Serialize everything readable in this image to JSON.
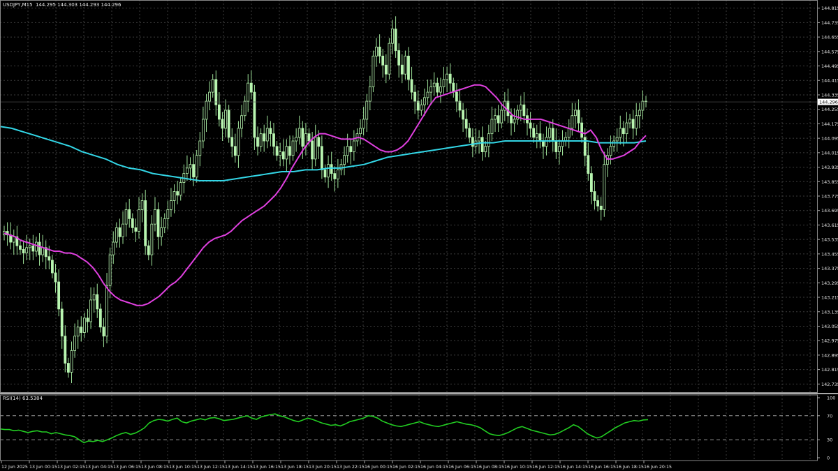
{
  "header": {
    "symbol": "USDJPY,M15",
    "ohlc": "144.295 144.303 144.293 144.296"
  },
  "rsi_header": {
    "label": "RSI(14) 63.5384"
  },
  "colors": {
    "background": "#000000",
    "grid": "#3c3c3c",
    "candle": "#b8f5b0",
    "wick": "#9fe39a",
    "ma_fast": "#e040e0",
    "ma_slow": "#33d6e6",
    "rsi": "#22cc22",
    "axis_text": "#e6e6e6"
  },
  "chart_data": [
    {
      "type": "candlestick",
      "title": "USDJPY,M15",
      "ylim": [
        142.69,
        144.86
      ],
      "yticks": [
        "144.815",
        "144.735",
        "144.655",
        "144.575",
        "144.495",
        "144.415",
        "144.335",
        "144.255",
        "144.175",
        "144.095",
        "144.015",
        "143.935",
        "143.855",
        "143.775",
        "143.695",
        "143.615",
        "143.535",
        "143.455",
        "143.375",
        "143.295",
        "143.215",
        "143.135",
        "143.055",
        "142.975",
        "142.895",
        "142.815",
        "142.735"
      ],
      "current_price": "144.296",
      "candles_close": [
        143.58,
        143.56,
        143.52,
        143.55,
        143.5,
        143.48,
        143.46,
        143.49,
        143.5,
        143.47,
        143.52,
        143.45,
        143.49,
        143.44,
        143.42,
        143.35,
        143.3,
        143.15,
        143.0,
        142.85,
        142.8,
        142.92,
        143.0,
        143.05,
        143.02,
        143.1,
        143.08,
        143.2,
        143.23,
        143.15,
        143.05,
        143.0,
        143.28,
        143.45,
        143.52,
        143.6,
        143.55,
        143.62,
        143.7,
        143.65,
        143.6,
        143.58,
        143.7,
        143.75,
        143.5,
        143.45,
        143.62,
        143.7,
        143.55,
        143.6,
        143.65,
        143.7,
        143.75,
        143.8,
        143.78,
        143.85,
        143.9,
        143.93,
        143.95,
        143.88,
        144.0,
        144.08,
        144.2,
        144.3,
        144.35,
        144.42,
        144.28,
        144.2,
        144.15,
        144.25,
        144.1,
        144.05,
        144.0,
        144.15,
        144.22,
        144.3,
        144.4,
        144.35,
        144.1,
        144.05,
        144.12,
        144.08,
        144.15,
        144.12,
        144.05,
        144.0,
        144.02,
        143.98,
        144.05,
        144.0,
        144.08,
        144.1,
        144.15,
        144.05,
        144.12,
        144.08,
        143.98,
        144.1,
        144.05,
        143.92,
        143.88,
        143.95,
        143.9,
        143.87,
        143.92,
        143.95,
        144.0,
        144.05,
        144.02,
        144.08,
        144.12,
        144.15,
        144.2,
        144.3,
        144.38,
        144.55,
        144.6,
        144.55,
        144.5,
        144.45,
        144.62,
        144.7,
        144.58,
        144.5,
        144.45,
        144.55,
        144.42,
        144.35,
        144.3,
        144.25,
        144.28,
        144.32,
        144.35,
        144.38,
        144.4,
        144.35,
        144.38,
        144.42,
        144.45,
        144.4,
        144.35,
        144.3,
        144.25,
        144.2,
        144.15,
        144.1,
        144.05,
        144.08,
        144.1,
        144.02,
        144.05,
        144.12,
        144.2,
        144.22,
        144.18,
        144.25,
        144.3,
        144.22,
        144.18,
        144.2,
        144.25,
        144.28,
        144.22,
        144.18,
        144.15,
        144.1,
        144.12,
        144.08,
        144.05,
        144.1,
        144.15,
        144.08,
        144.02,
        144.05,
        144.08,
        144.1,
        144.15,
        144.22,
        144.25,
        144.18,
        144.1,
        144.0,
        143.9,
        143.8,
        143.75,
        143.72,
        143.7,
        143.95,
        144.0,
        144.05,
        144.08,
        144.1,
        144.15,
        144.12,
        144.18,
        144.2,
        144.15,
        144.22,
        144.25,
        144.3,
        144.296
      ],
      "ma_fast_values": [
        143.57,
        143.56,
        143.55,
        143.53,
        143.52,
        143.51,
        143.5,
        143.49,
        143.48,
        143.47,
        143.47,
        143.46,
        143.46,
        143.45,
        143.43,
        143.41,
        143.38,
        143.34,
        143.29,
        143.25,
        143.22,
        143.2,
        143.19,
        143.18,
        143.17,
        143.17,
        143.18,
        143.2,
        143.22,
        143.25,
        143.28,
        143.3,
        143.33,
        143.37,
        143.41,
        143.45,
        143.49,
        143.52,
        143.54,
        143.55,
        143.56,
        143.58,
        143.61,
        143.64,
        143.66,
        143.68,
        143.7,
        143.72,
        143.75,
        143.78,
        143.82,
        143.87,
        143.93,
        143.98,
        144.03,
        144.07,
        144.1,
        144.12,
        144.12,
        144.11,
        144.1,
        144.09,
        144.09,
        144.09,
        144.1,
        144.09,
        144.07,
        144.05,
        144.03,
        144.02,
        144.02,
        144.03,
        144.05,
        144.08,
        144.13,
        144.18,
        144.23,
        144.28,
        144.32,
        144.33,
        144.34,
        144.35,
        144.36,
        144.37,
        144.38,
        144.39,
        144.39,
        144.38,
        144.35,
        144.32,
        144.28,
        144.25,
        144.22,
        144.21,
        144.2,
        144.2,
        144.2,
        144.2,
        144.19,
        144.18,
        144.17,
        144.16,
        144.15,
        144.14,
        144.13,
        144.12,
        144.14,
        144.1,
        144.03,
        143.98,
        143.98,
        143.99,
        144.0,
        144.02,
        144.04,
        144.08,
        144.11
      ],
      "ma_slow_values": [
        144.16,
        144.15,
        144.13,
        144.11,
        144.09,
        144.07,
        144.05,
        144.02,
        144.0,
        143.98,
        143.95,
        143.93,
        143.92,
        143.9,
        143.89,
        143.88,
        143.87,
        143.86,
        143.86,
        143.86,
        143.87,
        143.88,
        143.89,
        143.9,
        143.91,
        143.91,
        143.92,
        143.92,
        143.93,
        143.93,
        143.94,
        143.95,
        143.97,
        143.99,
        144.0,
        144.01,
        144.02,
        144.03,
        144.04,
        144.05,
        144.06,
        144.07,
        144.07,
        144.08,
        144.08,
        144.08,
        144.08,
        144.08,
        144.08,
        144.08,
        144.08,
        144.07,
        144.07,
        144.07,
        144.07,
        144.08
      ],
      "xticks": [
        "12 Jun 2025",
        "13 Jun 00:15",
        "13 Jun 02:15",
        "13 Jun 04:15",
        "13 Jun 06:15",
        "13 Jun 08:15",
        "13 Jun 10:15",
        "13 Jun 12:15",
        "13 Jun 14:15",
        "13 Jun 16:15",
        "13 Jun 18:15",
        "13 Jun 20:15",
        "13 Jun 22:15",
        "16 Jun 00:15",
        "16 Jun 02:15",
        "16 Jun 04:15",
        "16 Jun 06:15",
        "16 Jun 08:15",
        "16 Jun 10:15",
        "16 Jun 12:15",
        "16 Jun 14:15",
        "16 Jun 16:15",
        "16 Jun 18:15",
        "16 Jun 20:15"
      ]
    },
    {
      "type": "line",
      "title": "RSI(14) 63.5384",
      "ylim": [
        0,
        100
      ],
      "yticks": [
        "100",
        "70",
        "30",
        "0"
      ],
      "levels": [
        70,
        30
      ],
      "values": [
        48,
        47,
        47,
        45,
        46,
        44,
        42,
        44,
        45,
        43,
        43,
        40,
        42,
        40,
        38,
        37,
        35,
        30,
        25,
        28,
        27,
        29,
        27,
        30,
        33,
        37,
        40,
        42,
        39,
        41,
        45,
        50,
        58,
        62,
        64,
        63,
        61,
        64,
        66,
        60,
        58,
        61,
        63,
        65,
        63,
        66,
        67,
        65,
        62,
        63,
        64,
        66,
        68,
        70,
        66,
        64,
        68,
        70,
        72,
        73,
        70,
        68,
        65,
        62,
        60,
        63,
        66,
        64,
        61,
        58,
        56,
        54,
        55,
        53,
        56,
        60,
        62,
        64,
        66,
        70,
        69,
        66,
        61,
        58,
        55,
        53,
        52,
        54,
        56,
        58,
        60,
        57,
        55,
        53,
        52,
        54,
        56,
        58,
        60,
        58,
        56,
        55,
        53,
        50,
        45,
        40,
        38,
        37,
        39,
        42,
        46,
        50,
        52,
        49,
        46,
        44,
        42,
        40,
        38,
        39,
        42,
        46,
        50,
        55,
        52,
        46,
        40,
        36,
        33,
        35,
        40,
        45,
        50,
        54,
        58,
        60,
        62,
        61,
        63,
        63.54
      ]
    }
  ]
}
